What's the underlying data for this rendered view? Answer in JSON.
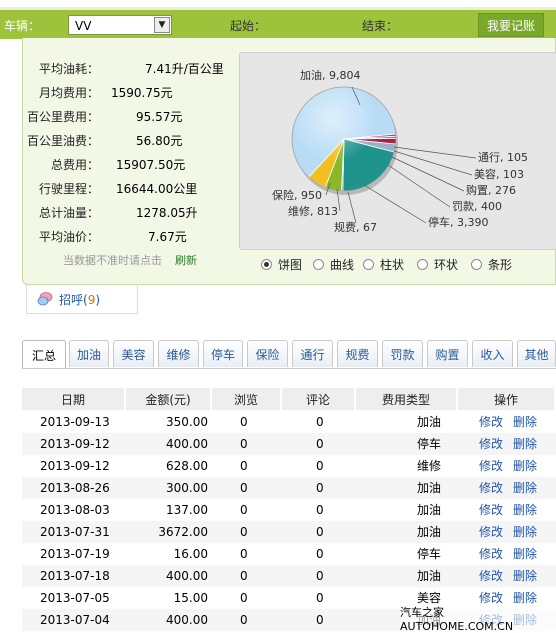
{
  "toolbar": {
    "car_label": "车辆：",
    "car_value": "VV",
    "start_label": "起始：",
    "end_label": "结束：",
    "record_button": "我要记账"
  },
  "stats": [
    {
      "label": "平均油耗：",
      "value": "7.41升/百公里"
    },
    {
      "label": "月均费用：",
      "value": "1590.75元"
    },
    {
      "label": "百公里费用：",
      "value": "95.57元"
    },
    {
      "label": "百公里油费：",
      "value": "56.80元"
    },
    {
      "label": "总费用：",
      "value": "15907.50元"
    },
    {
      "label": "行驶里程：",
      "value": "16644.00公里"
    },
    {
      "label": "总计油量：",
      "value": "1278.05升"
    },
    {
      "label": "平均油价：",
      "value": "7.67元"
    }
  ],
  "note": "当数据不准时请点击",
  "refresh_link": "刷新",
  "chart_data": {
    "type": "pie",
    "slices": [
      {
        "name": "加油",
        "value": 9804,
        "label": "加油, 9,804",
        "color": "#b8dcf6"
      },
      {
        "name": "通行",
        "value": 105,
        "label": "通行, 105",
        "color": "#a04a7a"
      },
      {
        "name": "美容",
        "value": 103,
        "label": "美容, 103",
        "color": "#c46a9a"
      },
      {
        "name": "购置",
        "value": 276,
        "label": "购置, 276",
        "color": "#b02040"
      },
      {
        "name": "罚款",
        "value": 400,
        "label": "罚款, 400",
        "color": "#9ab0c8"
      },
      {
        "name": "停车",
        "value": 3390,
        "label": "停车, 3,390",
        "color": "#1e948c"
      },
      {
        "name": "规费",
        "value": 67,
        "label": "规费, 67",
        "color": "#6a6a6a"
      },
      {
        "name": "维修",
        "value": 813,
        "label": "维修, 813",
        "color": "#8ab82a"
      },
      {
        "name": "保险",
        "value": 950,
        "label": "保险, 950",
        "color": "#f0c020"
      }
    ]
  },
  "chart_types": [
    {
      "label": "饼图",
      "selected": true
    },
    {
      "label": "曲线",
      "selected": false
    },
    {
      "label": "柱状",
      "selected": false
    },
    {
      "label": "环状",
      "selected": false
    },
    {
      "label": "条形",
      "selected": false
    }
  ],
  "greet": {
    "label": "招呼",
    "open": "(",
    "count": "9",
    "close": ")"
  },
  "tabs": [
    "汇总",
    "加油",
    "美容",
    "维修",
    "停车",
    "保险",
    "通行",
    "规费",
    "罚款",
    "购置",
    "收入",
    "其他"
  ],
  "table": {
    "headers": [
      "日期",
      "金额(元)",
      "浏览",
      "评论",
      "费用类型",
      "操作"
    ],
    "rows": [
      {
        "date": "2013-09-13",
        "amount": "350.00",
        "views": "0",
        "comments": "0",
        "type": "加油"
      },
      {
        "date": "2013-09-12",
        "amount": "400.00",
        "views": "0",
        "comments": "0",
        "type": "停车"
      },
      {
        "date": "2013-09-12",
        "amount": "628.00",
        "views": "0",
        "comments": "0",
        "type": "维修"
      },
      {
        "date": "2013-08-26",
        "amount": "300.00",
        "views": "0",
        "comments": "0",
        "type": "加油"
      },
      {
        "date": "2013-08-03",
        "amount": "137.00",
        "views": "0",
        "comments": "0",
        "type": "加油"
      },
      {
        "date": "2013-07-31",
        "amount": "3672.00",
        "views": "0",
        "comments": "0",
        "type": "加油"
      },
      {
        "date": "2013-07-19",
        "amount": "16.00",
        "views": "0",
        "comments": "0",
        "type": "停车"
      },
      {
        "date": "2013-07-18",
        "amount": "400.00",
        "views": "0",
        "comments": "0",
        "type": "加油"
      },
      {
        "date": "2013-07-05",
        "amount": "15.00",
        "views": "0",
        "comments": "0",
        "type": "美容"
      },
      {
        "date": "2013-07-04",
        "amount": "400.00",
        "views": "0",
        "comments": "0",
        "type": "加油"
      }
    ],
    "edit_label": "修改",
    "delete_label": "删除"
  },
  "watermark": "汽车之家 AUTOHOME.COM.CN"
}
